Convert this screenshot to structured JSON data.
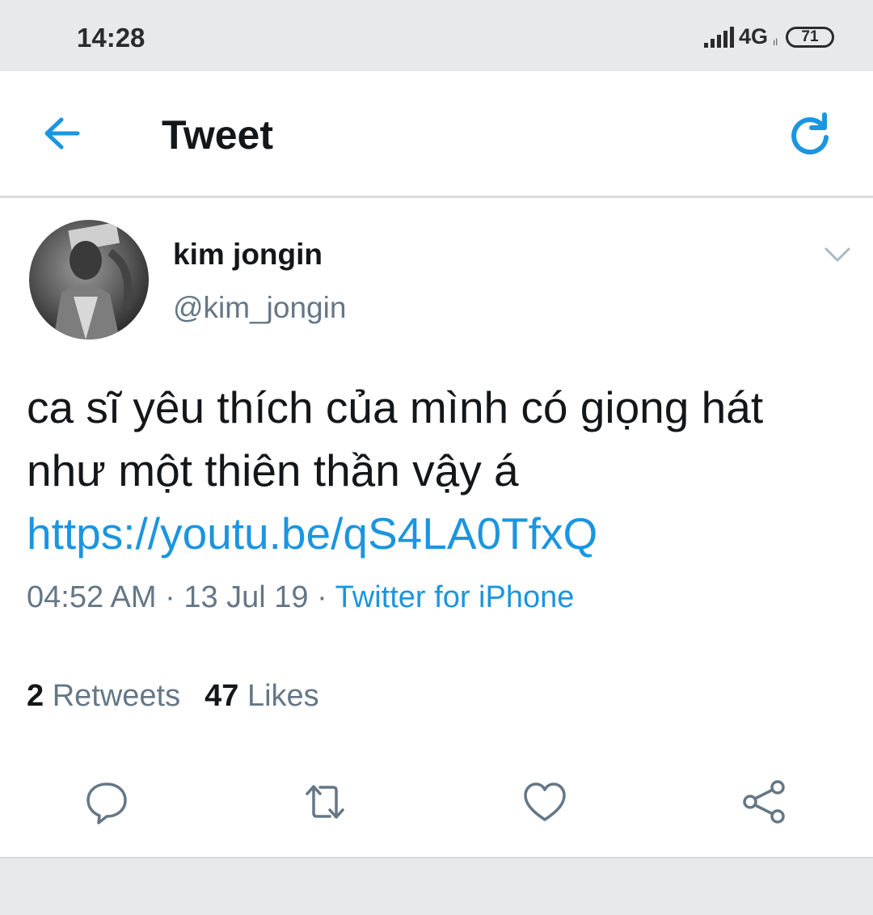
{
  "status_bar": {
    "time": "14:28",
    "network": "4G",
    "network_sub": "ıl",
    "battery": "71"
  },
  "app_bar": {
    "back_icon": "arrow-left-icon",
    "title": "Tweet",
    "refresh_icon": "refresh-icon"
  },
  "tweet": {
    "display_name": "kim jongin",
    "handle": "@kim_jongin",
    "text_line1": "ca sĩ yêu thích của mình có giọng hát",
    "text_line2": "như một thiên thần vậy á",
    "link": "https://youtu.be/qS4LA0TfxQ",
    "time": "04:52 AM",
    "date": "13 Jul 19",
    "separator": " · ",
    "source": "Twitter for iPhone",
    "retweet_count": "2",
    "retweet_label": "Retweets",
    "like_count": "47",
    "like_label": "Likes"
  },
  "actions": [
    {
      "icon": "reply-icon"
    },
    {
      "icon": "retweet-icon"
    },
    {
      "icon": "heart-icon"
    },
    {
      "icon": "share-icon"
    }
  ],
  "colors": {
    "accent": "#1b95e0",
    "text": "#14171a",
    "secondary": "#657786",
    "status_bar_bg": "#e8e9eb"
  }
}
